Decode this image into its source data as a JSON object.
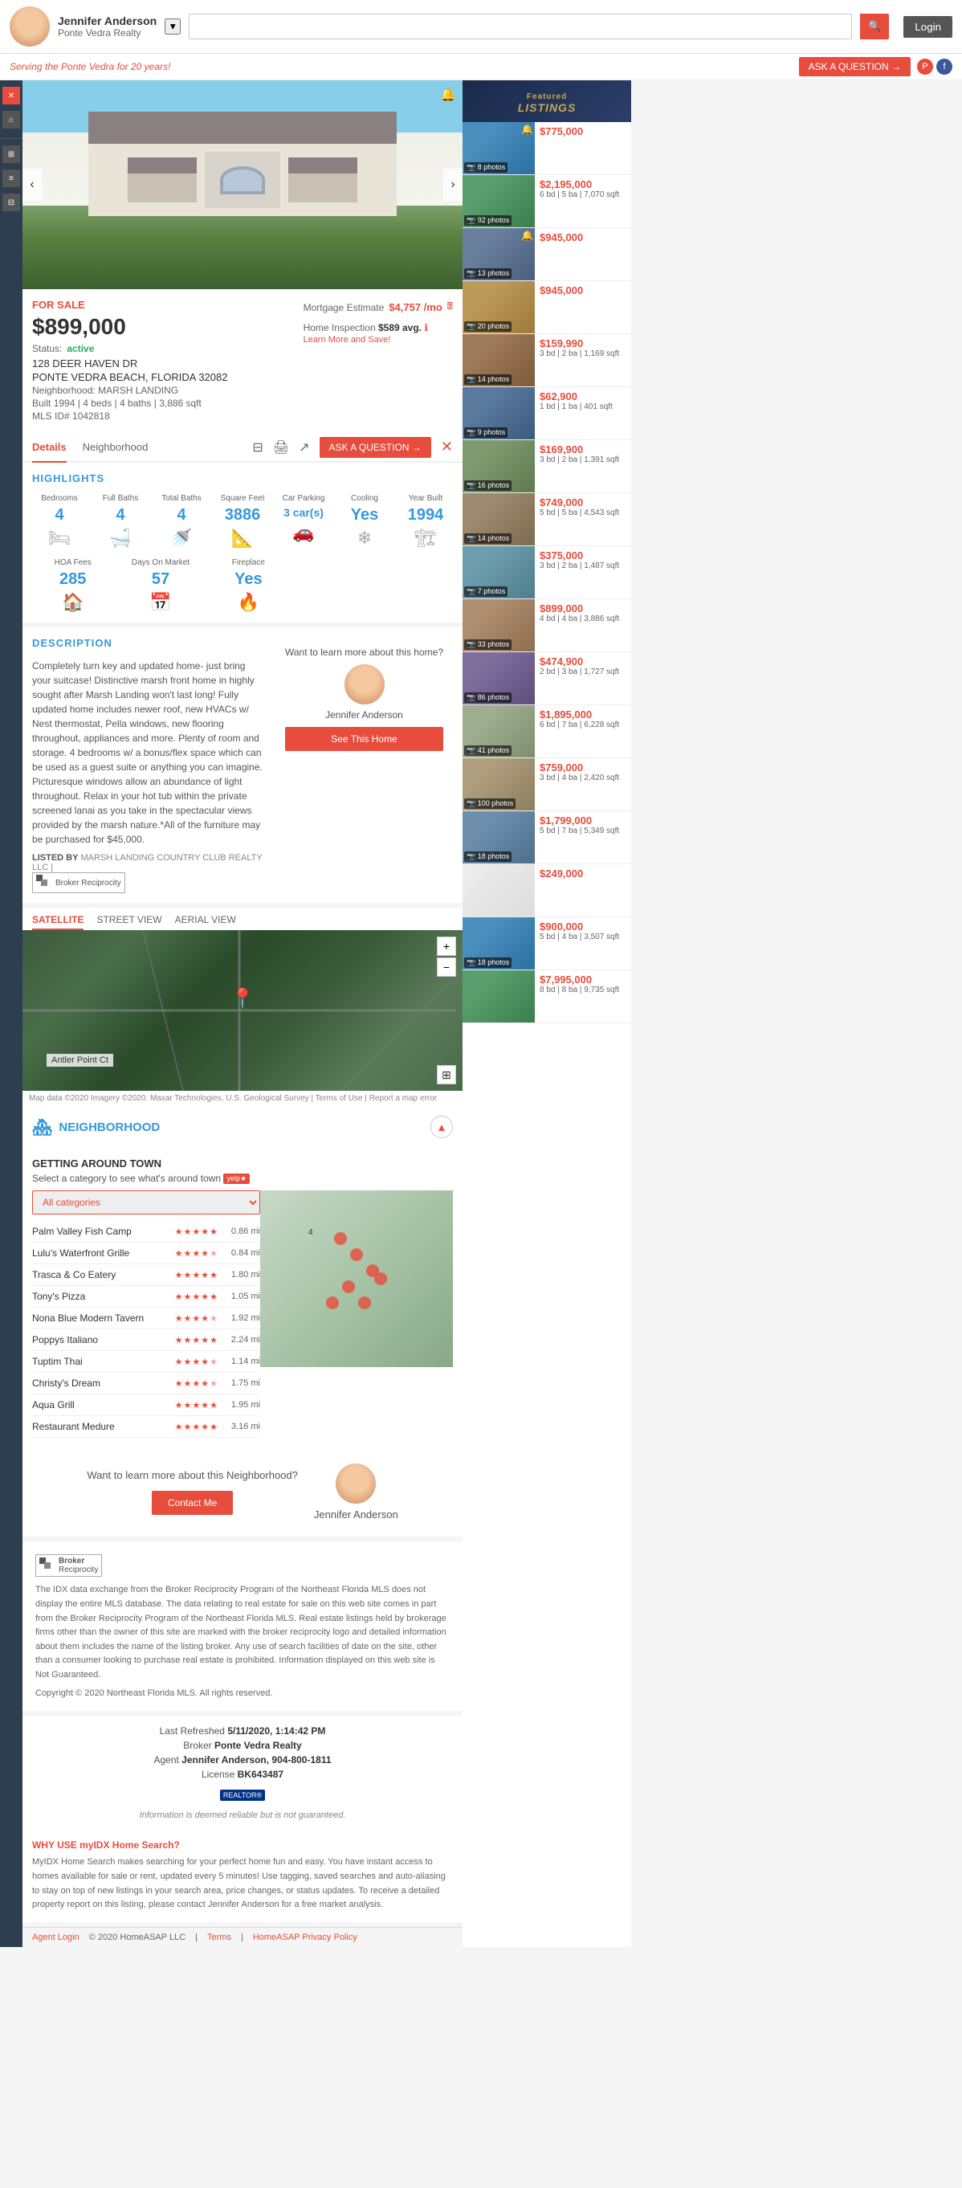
{
  "header": {
    "agent_name": "Jennifer Anderson",
    "agency": "Ponte Vedra Realty",
    "search_placeholder": "",
    "login_label": "Login",
    "serving_text": "Serving the Ponte Vedra for 20 years!",
    "ask_btn": "ASK A QUESTION →"
  },
  "property": {
    "sale_status": "FOR SALE",
    "price": "$899,000",
    "status": "active",
    "status_label": "Status:",
    "address_line1": "128 DEER HAVEN DR",
    "address_line2": "PONTE VEDRA BEACH, FLORIDA 32082",
    "neighborhood_label": "Neighborhood:",
    "neighborhood": "MARSH LANDING",
    "built_label": "Built",
    "built_year": "1994",
    "beds": "4 beds",
    "baths": "4 baths",
    "sqft": "3,886 sqft",
    "mls_label": "MLS ID#",
    "mls_id": "1042818",
    "mortgage_label": "Mortgage Estimate",
    "mortgage_amount": "$4,757 /mo",
    "inspection_label": "Home Inspection",
    "inspection_amount": "$589 avg.",
    "learn_link": "Learn More and Save!"
  },
  "tabs": {
    "details": "Details",
    "neighborhood": "Neighborhood",
    "ask_btn": "ASK A QUESTION →"
  },
  "highlights": {
    "title": "HIGHLIGHTS",
    "labels": [
      "Bedrooms",
      "Full Baths",
      "Total Baths",
      "Square Feet",
      "Car Parking",
      "Cooling",
      "Year Built",
      "HOA Fees",
      "Days On Market",
      "Fireplace"
    ],
    "values": [
      "4",
      "4",
      "4",
      "3886",
      "3 car(s)",
      "Yes",
      "1994",
      "285",
      "57",
      "Yes"
    ]
  },
  "description": {
    "title": "DESCRIPTION",
    "text": "Completely turn key and updated home- just bring your suitcase! Distinctive marsh front home in highly sought after Marsh Landing won't last long! Fully updated home includes newer roof, new HVACs w/ Nest thermostat, Pella windows, new flooring throughout, appliances and more. Plenty of room and storage. 4 bedrooms w/ a bonus/flex space which can be used as a guest suite or anything you can imagine. Picturesque windows allow an abundance of light throughout. Relax in your hot tub within the private screened lanai as you take in the spectacular views provided by the marsh nature.*All of the furniture may be purchased for $45,000.",
    "listed_by": "LISTED BY",
    "broker_name": "MARSH LANDING COUNTRY CLUB REALTY LLC |",
    "agent_prompt": "Want to learn more about this home?",
    "agent_name": "Jennifer Anderson",
    "see_home_btn": "See This Home"
  },
  "map_tabs": {
    "satellite": "SATELLITE",
    "street": "STREET VIEW",
    "aerial": "AERIAL VIEW"
  },
  "map": {
    "location_label": "Antler Point Ct",
    "plus": "+",
    "minus": "−",
    "footer_text": "Map data ©2020 Imagery ©2020. Maxar Technologies, U.S. Geological Survey | Terms of Use | Report a map error"
  },
  "neighborhood": {
    "title": "NEIGHBORHOOD",
    "getting_around": "GETTING AROUND TOWN",
    "select_text": "Select a category to see what's around town",
    "category_default": "All categories",
    "pois": [
      {
        "name": "Palm Valley Fish Camp",
        "stars": 5,
        "dist": "0.86 mi"
      },
      {
        "name": "Lulu's Waterfront Grille",
        "stars": 4.5,
        "dist": "0.84 mi"
      },
      {
        "name": "Trasca & Co Eatery",
        "stars": 5,
        "dist": "1.80 mi"
      },
      {
        "name": "Tony's Pizza",
        "stars": 5,
        "dist": "1.05 mi"
      },
      {
        "name": "Nona Blue Modern Tavern",
        "stars": 4.5,
        "dist": "1.92 mi"
      },
      {
        "name": "Poppys Italiano",
        "stars": 5,
        "dist": "2.24 mi"
      },
      {
        "name": "Tuptim Thai",
        "stars": 4.5,
        "dist": "1.14 mi"
      },
      {
        "name": "Christy's Dream",
        "stars": 4.5,
        "dist": "1.75 mi"
      },
      {
        "name": "Aqua Grill",
        "stars": 5,
        "dist": "1.95 mi"
      },
      {
        "name": "Restaurant Medure",
        "stars": 5,
        "dist": "3.16 mi"
      }
    ],
    "contact_prompt": "Want to learn more about this Neighborhood?",
    "contact_btn": "Contact Me",
    "agent_name": "Jennifer Anderson"
  },
  "idx": {
    "text": "The IDX data exchange from the Broker Reciprocity Program of the Northeast Florida MLS does not display the entire MLS database. The data relating to real estate for sale on this web site comes in part from the Broker Reciprocity Program of the Northeast Florida MLS. Real estate listings held by brokerage firms other than the owner of this site are marked with the broker reciprocity logo and detailed information about them includes the name of the listing broker. Any use of search facilities of date on the site, other than a consumer looking to purchase real estate is prohibited. Information displayed on this web site is Not Guaranteed.",
    "copyright": "Copyright © 2020 Northeast Florida MLS. All rights reserved."
  },
  "footer_meta": {
    "last_refreshed_label": "Last Refreshed",
    "last_refreshed": "5/11/2020, 1:14:42 PM",
    "broker_label": "Broker",
    "broker": "Ponte Vedra Realty",
    "agent_label": "Agent",
    "agent": "Jennifer Anderson, 904-800-1811",
    "license_label": "License",
    "license": "BK643487",
    "reliable_text": "Information is deemed reliable but is not guaranteed."
  },
  "myidx": {
    "title": "WHY USE myIDX Home Search?",
    "text": "MyIDX Home Search makes searching for your perfect home fun and easy. You have instant access to homes available for sale or rent, updated every 5 minutes! Use tagging, saved searches and auto-aliasing to stay on top of new listings in your search area, price changes, or status updates. To receive a detailed property report on this listing, please contact Jennifer Anderson for a free market analysis."
  },
  "bottom_bar": {
    "agent_login": "Agent Login",
    "copyright": "© 2020 HomeASAP LLC",
    "terms": "Terms",
    "privacy": "HomeASAP Privacy Policy"
  },
  "listings": {
    "header": "Featured LISTINGS",
    "items": [
      {
        "price": "$775,000",
        "beds": "",
        "baths": "",
        "sqft": "",
        "photos": "8 photos",
        "thumb": "1",
        "has_bell": true
      },
      {
        "price": "$2,195,000",
        "beds": "6 bd",
        "baths": "5 ba",
        "sqft": "7,070 sqft",
        "photos": "92 photos",
        "thumb": "2",
        "has_bell": false
      },
      {
        "price": "$945,000",
        "beds": "",
        "baths": "",
        "sqft": "",
        "photos": "13 photos",
        "thumb": "3",
        "has_bell": true
      },
      {
        "price": "$945,000",
        "beds": "",
        "baths": "",
        "sqft": "",
        "photos": "20 photos",
        "thumb": "4",
        "has_bell": false
      },
      {
        "price": "$159,990",
        "beds": "3 bd",
        "baths": "2 ba",
        "sqft": "1,169 sqft",
        "photos": "14 photos",
        "thumb": "5",
        "has_bell": false
      },
      {
        "price": "$62,900",
        "beds": "1 bd",
        "baths": "1 ba",
        "sqft": "401 sqft",
        "photos": "9 photos",
        "thumb": "6",
        "has_bell": false
      },
      {
        "price": "$169,900",
        "beds": "3 bd",
        "baths": "2 ba",
        "sqft": "1,391 sqft",
        "photos": "16 photos",
        "thumb": "7",
        "has_bell": false
      },
      {
        "price": "$749,000",
        "beds": "5 bd",
        "baths": "5 ba",
        "sqft": "4,543 sqft",
        "photos": "14 photos",
        "thumb": "8",
        "has_bell": false
      },
      {
        "price": "$375,000",
        "beds": "3 bd",
        "baths": "2 ba",
        "sqft": "1,487 sqft",
        "photos": "7 photos",
        "thumb": "9",
        "has_bell": false
      },
      {
        "price": "$899,000",
        "beds": "4 bd",
        "baths": "4 ba",
        "sqft": "3,886 sqft",
        "photos": "33 photos",
        "thumb": "10",
        "has_bell": false
      },
      {
        "price": "$474,900",
        "beds": "2 bd",
        "baths": "3 ba",
        "sqft": "1,727 sqft",
        "photos": "86 photos",
        "thumb": "11",
        "has_bell": false
      },
      {
        "price": "$1,895,000",
        "beds": "6 bd",
        "baths": "7 ba",
        "sqft": "6,228 sqft",
        "photos": "41 photos",
        "thumb": "12",
        "has_bell": false
      },
      {
        "price": "$759,000",
        "beds": "3 bd",
        "baths": "4 ba",
        "sqft": "2,420 sqft",
        "photos": "100 photos",
        "thumb": "13",
        "has_bell": false
      },
      {
        "price": "$1,799,000",
        "beds": "5 bd",
        "baths": "7 ba",
        "sqft": "5,349 sqft",
        "photos": "18 photos",
        "thumb": "14",
        "has_bell": false
      },
      {
        "price": "$249,000",
        "beds": "",
        "baths": "",
        "sqft": "",
        "photos": "",
        "thumb": "map",
        "has_bell": false
      },
      {
        "price": "$900,000",
        "beds": "5 bd",
        "baths": "4 ba",
        "sqft": "3,507 sqft",
        "photos": "18 photos",
        "thumb": "1",
        "has_bell": false
      },
      {
        "price": "$7,995,000",
        "beds": "8 bd",
        "baths": "8 ba",
        "sqft": "9,735 sqft",
        "photos": "",
        "thumb": "2",
        "has_bell": false
      }
    ]
  }
}
